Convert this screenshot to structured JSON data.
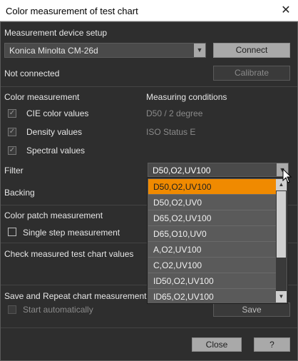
{
  "window": {
    "title": "Color measurement of test chart",
    "close_glyph": "✕"
  },
  "device": {
    "section_label": "Measurement device setup",
    "selected": "Konica Minolta CM-26d",
    "connect_label": "Connect",
    "status": "Not connected",
    "calibrate_label": "Calibrate"
  },
  "color_measurement": {
    "label": "Color measurement",
    "options": [
      {
        "label": "CIE color values",
        "checked": true
      },
      {
        "label": "Density values",
        "checked": true
      },
      {
        "label": "Spectral values",
        "checked": true
      }
    ]
  },
  "measuring_conditions": {
    "label": "Measuring conditions",
    "values": [
      "D50 / 2 degree",
      "ISO Status E"
    ]
  },
  "filter": {
    "label": "Filter",
    "selected": "D50,O2,UV100",
    "options": [
      "D50,O2,UV100",
      "D50,O2,UV0",
      "D65,O2,UV100",
      "D65,O10,UV0",
      "A,O2,UV100",
      "C,O2,UV100",
      "ID50,O2,UV100",
      "ID65,O2,UV100"
    ],
    "highlighted_index": 0
  },
  "backing": {
    "label": "Backing"
  },
  "patch": {
    "label": "Color patch measurement",
    "single_step_label": "Single step measurement",
    "single_step_checked": false
  },
  "check": {
    "label": "Check measured test chart values"
  },
  "save_repeat": {
    "label": "Save and Repeat chart measurement",
    "start_auto_label": "Start automatically",
    "save_label": "Save"
  },
  "footer": {
    "close_label": "Close",
    "help_label": "?"
  },
  "colors": {
    "highlight": "#f08a00",
    "button": "#a9a9a9",
    "background": "#2e2e2e"
  },
  "icons": {
    "check": "✓",
    "arrow_down": "▼",
    "arrow_up": "▲"
  }
}
